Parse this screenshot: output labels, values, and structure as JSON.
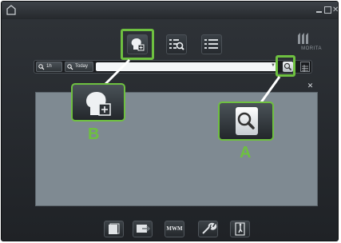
{
  "window": {
    "controls": [
      "minimize-icon",
      "maximize-icon",
      "close-icon"
    ]
  },
  "toolbar": {
    "buttons": [
      {
        "name": "new-patient-icon",
        "active": true
      },
      {
        "name": "search-list-icon",
        "active": false
      },
      {
        "name": "list-view-icon",
        "active": false
      }
    ]
  },
  "logo": {
    "text": "MORITA"
  },
  "search": {
    "btn_1h": "1h",
    "btn_today": "Today",
    "input_value": "",
    "search_icon": "search-icon",
    "extra_icon": "list-grid-icon"
  },
  "callouts": {
    "a": {
      "letter": "A",
      "icon": "search-icon"
    },
    "b": {
      "letter": "B",
      "icon": "new-patient-icon"
    }
  },
  "bottom_toolbar": {
    "buttons": [
      "patient-folder-icon",
      "export-icon",
      "mwm-button",
      "settings-wrench-icon",
      "exit-icon"
    ],
    "mwm_label": "MWM"
  },
  "colors": {
    "highlight": "#6ec040",
    "panel_bg": "#2a2e33",
    "results_bg": "#7f8a92"
  }
}
